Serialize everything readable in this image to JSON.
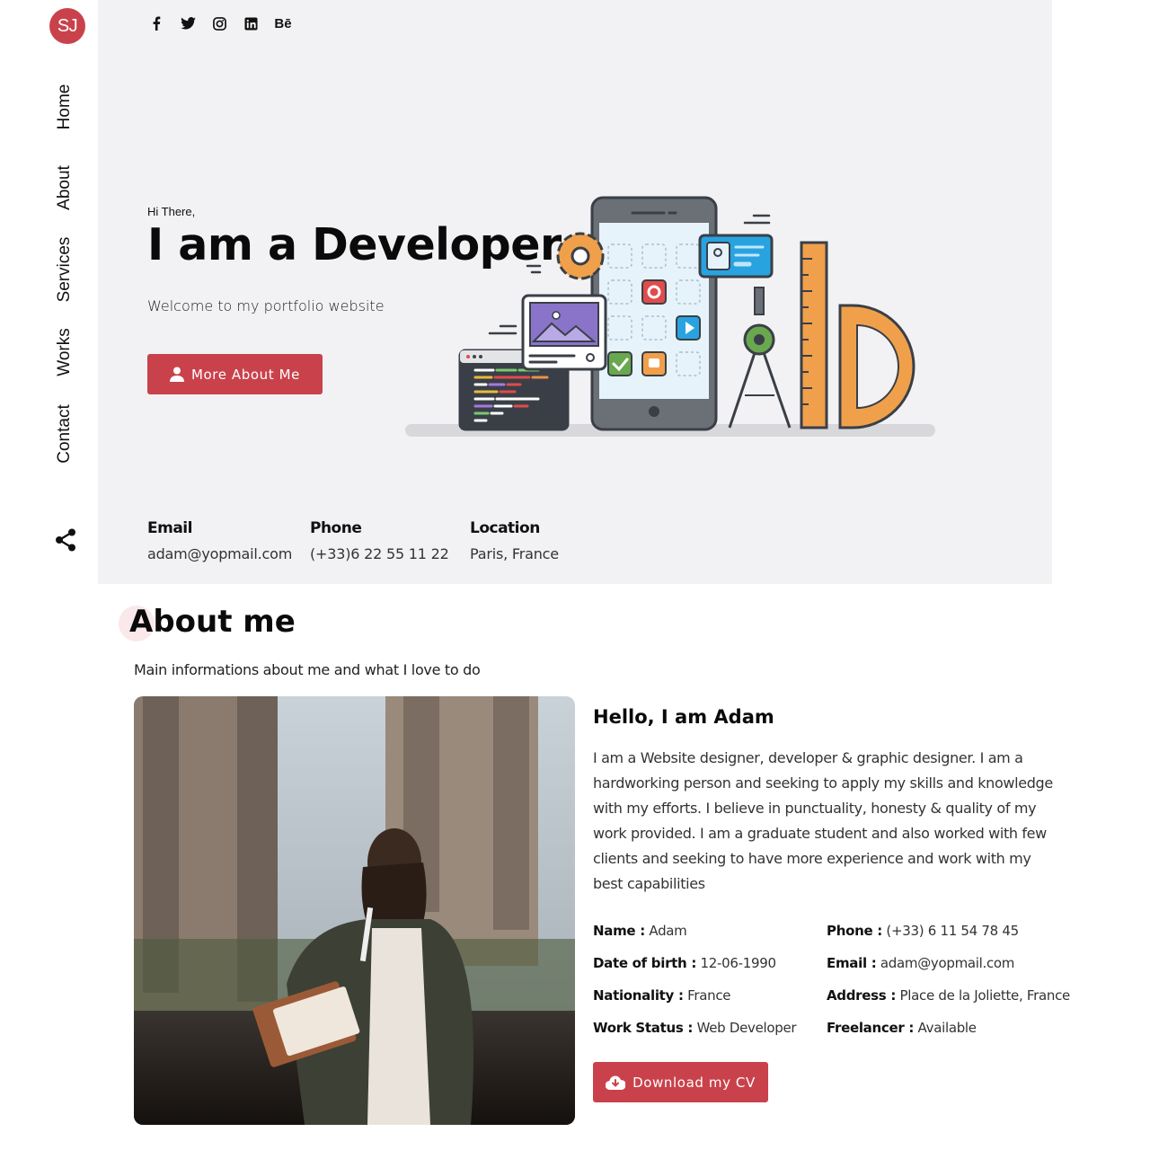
{
  "sidebar": {
    "logo": "SJ",
    "nav": [
      "Home",
      "About",
      "Services",
      "Works",
      "Contact"
    ],
    "share_icon": "share-icon"
  },
  "hero": {
    "socials": [
      {
        "name": "facebook-icon",
        "glyph": "f"
      },
      {
        "name": "twitter-icon",
        "glyph": "t"
      },
      {
        "name": "instagram-icon",
        "glyph": "i"
      },
      {
        "name": "linkedin-icon",
        "glyph": "in"
      },
      {
        "name": "behance-icon",
        "glyph": "Bē"
      }
    ],
    "greeting": "Hi There,",
    "title": "I am a Developer",
    "subtitle": "Welcome to my portfolio website",
    "button_label": "More About Me",
    "contacts": [
      {
        "label": "Email",
        "value": "adam@yopmail.com"
      },
      {
        "label": "Phone",
        "value": "(+33)6 22 55 11 22"
      },
      {
        "label": "Location",
        "value": "Paris, France"
      }
    ]
  },
  "about": {
    "title": "About me",
    "subtitle": "Main informations about me and what I love to do",
    "hello": "Hello, I am Adam",
    "bio": "I am a Website designer, developer & graphic designer. I am a hardworking person and seeking to apply my skills and knowledge with my efforts. I believe in punctuality, honesty & quality of my work provided. I am a graduate student and also worked with few clients and seeking to have more experience and work with my best capabilities",
    "details_left": [
      {
        "label": "Name :",
        "value": "Adam"
      },
      {
        "label": "Date of birth :",
        "value": "12-06-1990"
      },
      {
        "label": "Nationality :",
        "value": "France"
      },
      {
        "label": "Work Status :",
        "value": " Web Developer"
      }
    ],
    "details_right": [
      {
        "label": "Phone :",
        "value": "(+33) 6 11 54 78 45"
      },
      {
        "label": "Email :",
        "value": "adam@yopmail.com"
      },
      {
        "label": "Address :",
        "value": "Place de la Joliette, France"
      },
      {
        "label": "Freelancer :",
        "value": " Available"
      }
    ],
    "cv_button": "Download my CV"
  },
  "colors": {
    "accent": "#c9424b",
    "hero_bg": "#f2f2f4"
  }
}
